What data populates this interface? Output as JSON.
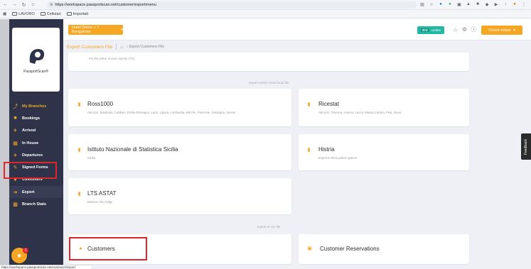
{
  "browser": {
    "url": "https://workspace.passportscan.net/customer/export/menu",
    "bookmarks": [
      "LAVORO",
      "Cellulari",
      "Importati"
    ]
  },
  "sidebar": {
    "logo_text": "PassportScan®",
    "items": [
      {
        "label": "My Branches",
        "icon": "branches-icon"
      },
      {
        "label": "Bookings",
        "icon": "bookings-icon"
      },
      {
        "label": "Arrived",
        "icon": "arrived-icon"
      },
      {
        "label": "In House",
        "icon": "in-house-icon"
      },
      {
        "label": "Departures",
        "icon": "departures-icon"
      },
      {
        "label": "Signed Forms",
        "icon": "signed-forms-icon"
      },
      {
        "label": "Customers",
        "icon": "customers-icon"
      },
      {
        "label": "Export",
        "icon": "export-icon"
      },
      {
        "label": "Branch Stats",
        "icon": "stats-icon"
      }
    ],
    "notification_count": "1"
  },
  "topbar": {
    "hotel_selector": "Hotel Demo + 7 Bungalows",
    "credit_value": "874",
    "credit_label": "credits",
    "checkin_button": "Check-in/out"
  },
  "breadcrumb": {
    "page_title": "Export Customers File",
    "trail": "Export Customers File"
  },
  "main": {
    "top_card_sub": "For the police of your country (ITA).",
    "section_local": "Export and/or Send local file",
    "section_csv": "Export in csv file",
    "cards": [
      {
        "title": "Ross1000",
        "sub": "Abruzzo, Basilicata, Calabria, Emilia-Romagna, Lazio, Liguria, Lombardia, Marche, Piemonte, Sardegna, Veneto"
      },
      {
        "title": "Ricestat",
        "sub": "Abruzzo, Toscana, Livorno, Lucca, Massa Carrara, Pisa, Siena"
      },
      {
        "title": "Istituto Nazionale di Statistica Sicilia",
        "sub": "Sicilia"
      },
      {
        "title": "Histria",
        "sub": "Export to third parties system"
      },
      {
        "title": "LTS ASTAT",
        "sub": "Bolzano-Alto Adige"
      },
      {
        "title": "Customers",
        "sub": ""
      },
      {
        "title": "Customer Reservations",
        "sub": ""
      }
    ],
    "feedback": "Feedback"
  },
  "status_bar": "https://workspace.passportscan.net/customer/export"
}
